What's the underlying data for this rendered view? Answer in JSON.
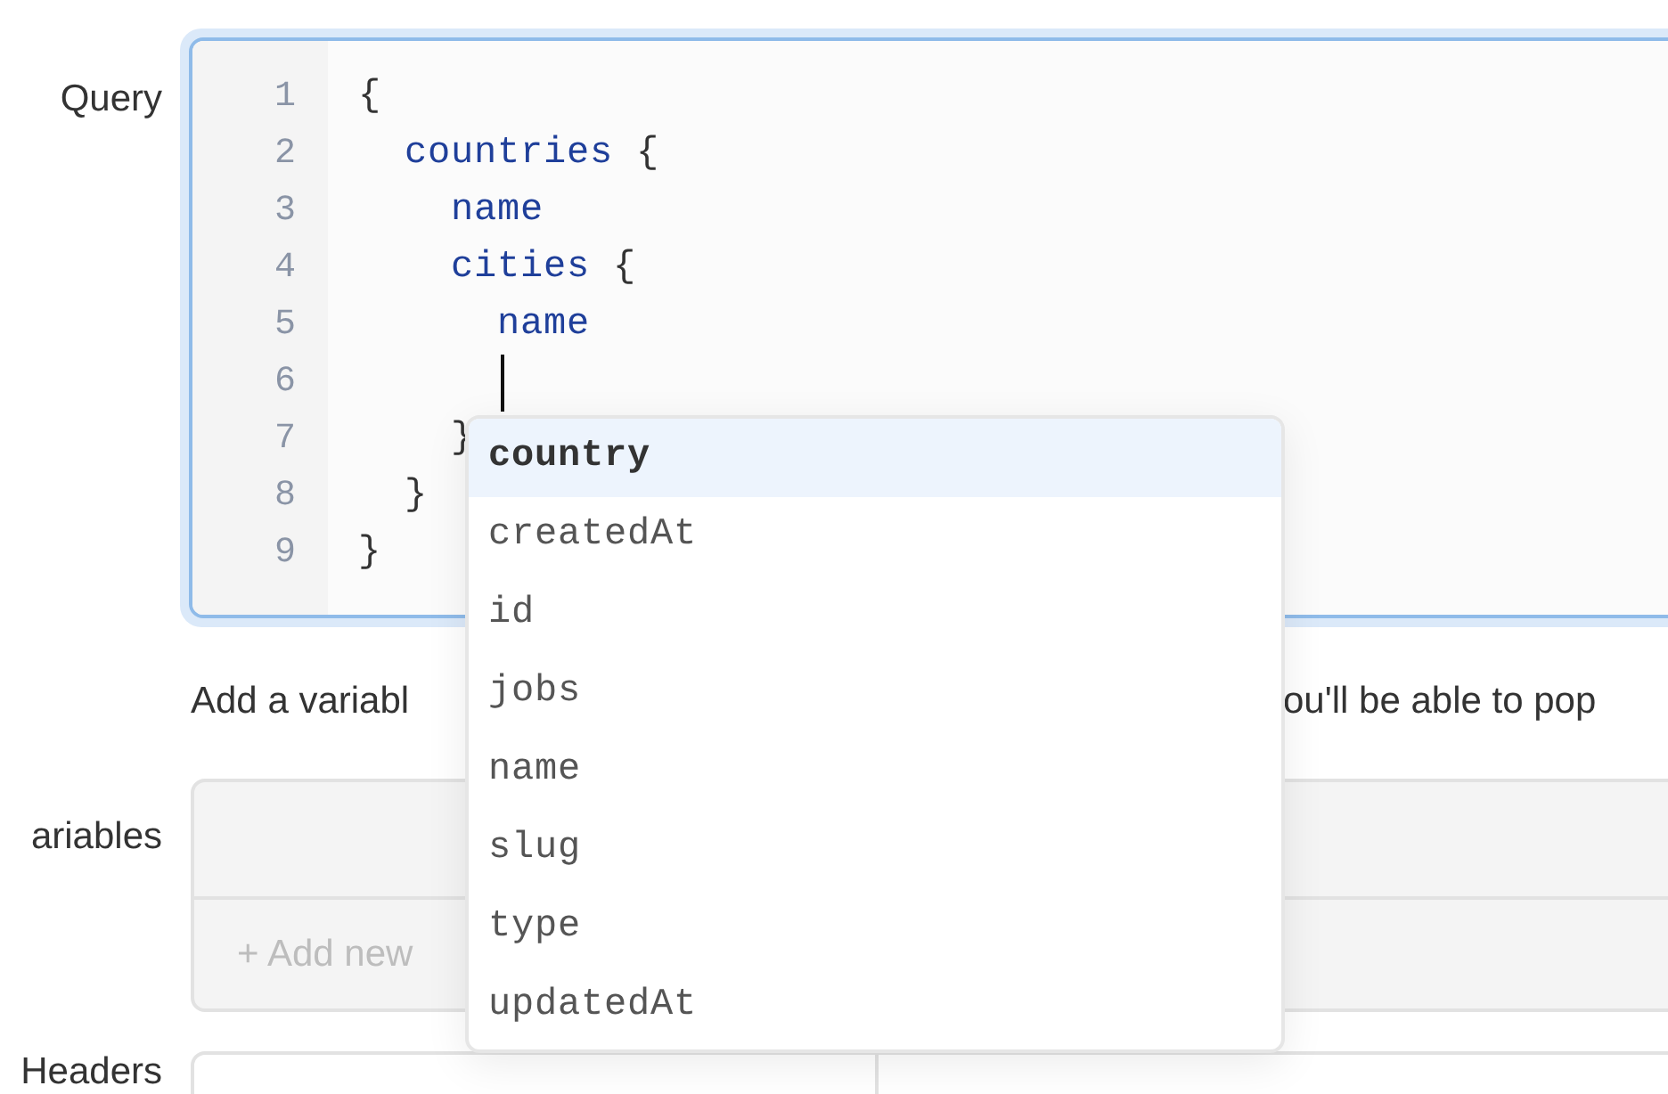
{
  "query": {
    "label": "Query",
    "lines": [
      {
        "number": "1",
        "tokens": [
          {
            "text": "{",
            "kind": "punct"
          }
        ]
      },
      {
        "number": "2",
        "tokens": [
          {
            "text": "  countries",
            "kind": "field"
          },
          {
            "text": " {",
            "kind": "punct"
          }
        ]
      },
      {
        "number": "3",
        "tokens": [
          {
            "text": "    name",
            "kind": "field"
          }
        ]
      },
      {
        "number": "4",
        "tokens": [
          {
            "text": "    cities",
            "kind": "field"
          },
          {
            "text": " {",
            "kind": "punct"
          }
        ]
      },
      {
        "number": "5",
        "tokens": [
          {
            "text": "      name",
            "kind": "field"
          }
        ]
      },
      {
        "number": "6",
        "cursor": true
      },
      {
        "number": "7",
        "tokens": [
          {
            "text": "    }",
            "kind": "punct"
          }
        ]
      },
      {
        "number": "8",
        "tokens": [
          {
            "text": "  }",
            "kind": "punct"
          }
        ]
      },
      {
        "number": "9",
        "tokens": [
          {
            "text": "}",
            "kind": "punct"
          }
        ]
      }
    ],
    "suggestions": [
      {
        "label": "country",
        "selected": true
      },
      {
        "label": "createdAt",
        "selected": false
      },
      {
        "label": "id",
        "selected": false
      },
      {
        "label": "jobs",
        "selected": false
      },
      {
        "label": "name",
        "selected": false
      },
      {
        "label": "slug",
        "selected": false
      },
      {
        "label": "type",
        "selected": false
      },
      {
        "label": "updatedAt",
        "selected": false
      }
    ]
  },
  "helper_text": {
    "left": "Add a variabl",
    "right": "ou'll be able to pop"
  },
  "variables": {
    "label": "ariables",
    "add_button": "+ Add new"
  },
  "headers": {
    "label": "Headers"
  }
}
